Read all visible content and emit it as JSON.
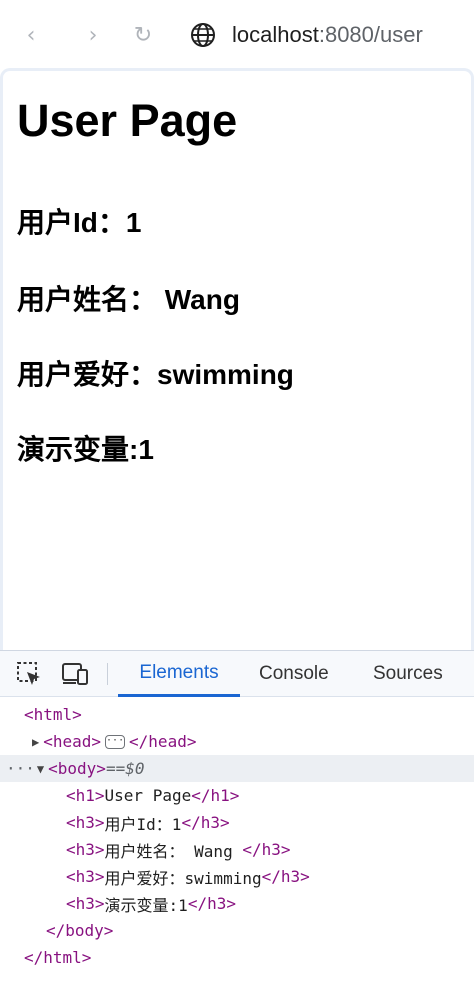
{
  "browser": {
    "back_icon": "‹",
    "forward_icon": "›",
    "reload_icon": "↻",
    "url_host": "localhost",
    "url_rest": ":8080/user"
  },
  "page": {
    "h1": "User Page",
    "h3_lines": [
      "用户Id：1",
      "用户姓名： Wang",
      "用户爱好：swimming",
      "演示变量:1"
    ]
  },
  "devtools": {
    "tabs": [
      "Elements",
      "Console",
      "Sources"
    ],
    "active_tab": "Elements",
    "dom": {
      "html_open": "<html>",
      "head_open": "<head>",
      "head_ellipsis": "···",
      "head_close": "</head>",
      "body_dots": "···",
      "body_open": "<body>",
      "body_eq": " == ",
      "body_var": "$0",
      "children": [
        {
          "open": "<h1>",
          "text": "User Page",
          "close": "</h1>"
        },
        {
          "open": "<h3>",
          "text": "用户Id：1",
          "close": "</h3>"
        },
        {
          "open": "<h3>",
          "text": "用户姓名： Wang ",
          "close": "</h3>"
        },
        {
          "open": "<h3>",
          "text": "用户爱好：swimming",
          "close": "</h3>"
        },
        {
          "open": "<h3>",
          "text": "演示变量:1",
          "close": "</h3>"
        }
      ],
      "body_close": "</body>",
      "html_close": "</html>"
    }
  },
  "colors": {
    "accent": "#1a66d2",
    "tag": "#881280"
  }
}
